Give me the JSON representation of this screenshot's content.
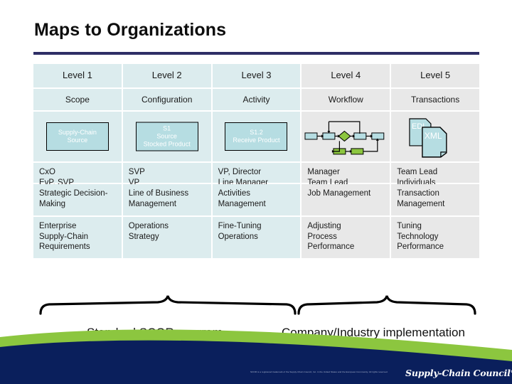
{
  "slide": {
    "title": "Maps to Organizations",
    "rule_color": "#2e2e66"
  },
  "matrix": {
    "levels": [
      "Level 1",
      "Level 2",
      "Level 3",
      "Level 4",
      "Level 5"
    ],
    "subtitles": [
      "Scope",
      "Configuration",
      "Activity",
      "Workflow",
      "Transactions"
    ],
    "diagram": {
      "level1_box": "Supply-Chain\nSource",
      "level1_box_line1": "Supply-Chain",
      "level1_box_line2": "Source",
      "level2_box_line1": "S1",
      "level2_box_line2": "Source",
      "level2_box_line3": "Stocked Product",
      "level3_box_line1": "S1.2",
      "level3_box_line2": "Receive Product",
      "level4_icon": "workflow-flowchart",
      "level5_doc1": "EDI",
      "level5_doc2": "XML"
    },
    "roles": [
      [
        "CxO",
        "EvP, SVP"
      ],
      [
        "SVP",
        "VP"
      ],
      [
        "VP, Director",
        "Line Manager"
      ],
      [
        "Manager",
        "Team Lead"
      ],
      [
        "Team Lead",
        "Individuals"
      ]
    ],
    "management": [
      [
        "Strategic Decision-",
        "Making"
      ],
      [
        "Line of Business",
        "Management"
      ],
      [
        "Activities",
        "Management"
      ],
      [
        "Job Management"
      ],
      [
        "Transaction",
        "Management"
      ]
    ],
    "needs": [
      [
        "Enterprise",
        "Supply-Chain",
        "Requirements"
      ],
      [
        "Operations",
        "Strategy"
      ],
      [
        "Fine-Tuning",
        "Operations"
      ],
      [
        "Adjusting",
        "Process",
        "Performance"
      ],
      [
        "Tuning",
        "Technology",
        "Performance"
      ]
    ],
    "colors": {
      "blue_cell": "#dcecee",
      "gray_cell": "#e8e8e8",
      "box_fill": "#b6dde2",
      "flow_green": "#8cc63f"
    }
  },
  "captions": {
    "left": "Standard SCOR program",
    "right": "Company/Industry implementation"
  },
  "footer": {
    "note": "SCOR is a registered trademark of the Supply-Chain Council, Inc. in the United States and the European Community. All rights reserved.",
    "logo": "Supply-Chain Council",
    "logo_mark": "®",
    "band_color": "#0a1f5c",
    "swoosh_color": "#8cc63f"
  }
}
